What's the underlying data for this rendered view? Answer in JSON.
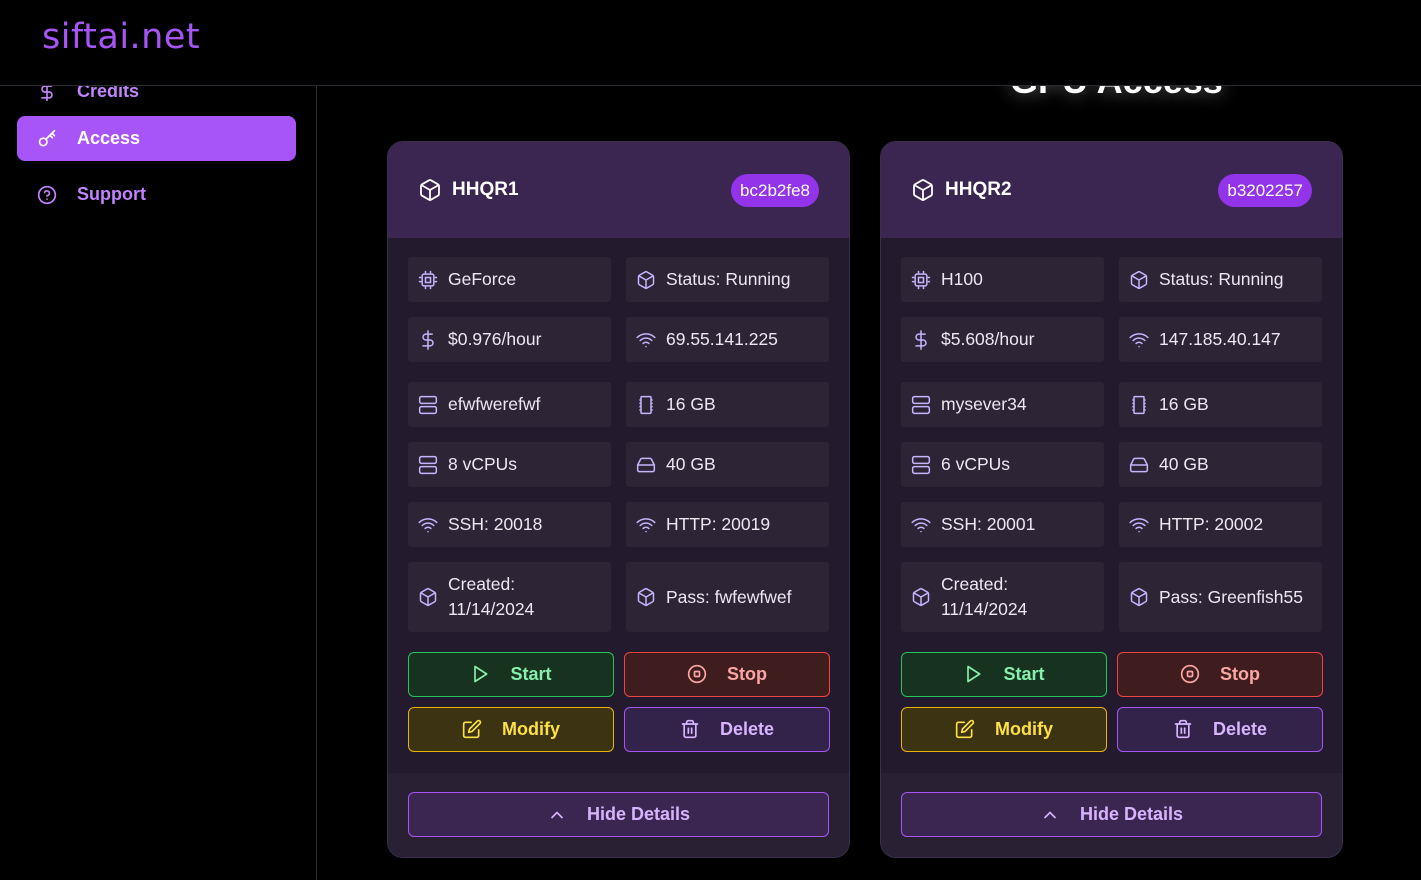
{
  "brand": "siftai.net",
  "page_title": "GPU Access",
  "sidebar": {
    "items": [
      {
        "label": "Credits",
        "icon": "dollar-icon"
      },
      {
        "label": "Access",
        "icon": "key-icon",
        "active": true
      },
      {
        "label": "Support",
        "icon": "help-circle-icon"
      }
    ]
  },
  "colors": {
    "accent": "#a855f7",
    "card_bg": "#231a2e",
    "header_bg": "#3a2650"
  },
  "cards": [
    {
      "name": "HHQR1",
      "badge": "bc2b2fe8",
      "gpu": "GeForce",
      "status": "Status: Running",
      "price": "$0.976/hour",
      "ip": "69.55.141.225",
      "server": "efwfwerefwf",
      "memory": "16 GB",
      "vcpus": "8 vCPUs",
      "storage": "40 GB",
      "ssh": "SSH: 20018",
      "http": "HTTP: 20019",
      "created_line1": "Created:",
      "created_line2": "11/14/2024",
      "pass": "Pass: fwfewfwef",
      "buttons": {
        "start": "Start",
        "stop": "Stop",
        "modify": "Modify",
        "delete": "Delete",
        "hide": "Hide Details"
      }
    },
    {
      "name": "HHQR2",
      "badge": "b3202257",
      "gpu": "H100",
      "status": "Status: Running",
      "price": "$5.608/hour",
      "ip": "147.185.40.147",
      "server": "mysever34",
      "memory": "16 GB",
      "vcpus": "6 vCPUs",
      "storage": "40 GB",
      "ssh": "SSH: 20001",
      "http": "HTTP: 20002",
      "created_line1": "Created:",
      "created_line2": "11/14/2024",
      "pass": "Pass: Greenfish55",
      "buttons": {
        "start": "Start",
        "stop": "Stop",
        "modify": "Modify",
        "delete": "Delete",
        "hide": "Hide Details"
      }
    }
  ]
}
